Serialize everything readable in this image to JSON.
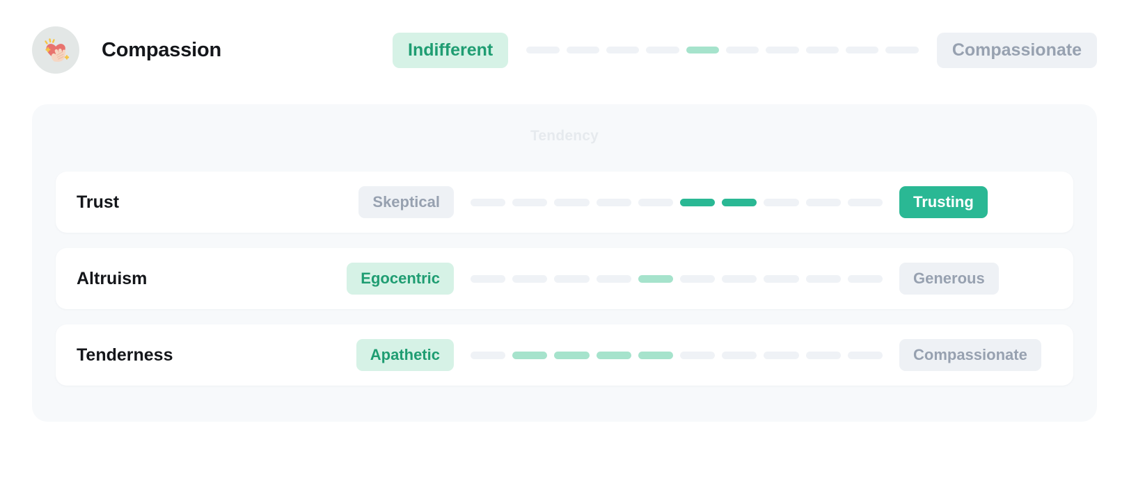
{
  "header": {
    "icon_name": "heart-with-hand-icon",
    "title": "Compassion",
    "left_label": "Indifferent",
    "right_label": "Compassionate",
    "segments_total": 10,
    "value_index": 4
  },
  "panel": {
    "heading": "Tendency"
  },
  "colors": {
    "accent_solid": "#2ab894",
    "accent_soft": "#a6e3cc",
    "badge_soft_bg": "#d6f2e6",
    "badge_soft_text": "#1f9d72",
    "badge_gray_bg": "#eef1f5",
    "badge_gray_text": "#97a1b0",
    "track_off": "#eff2f6",
    "panel_bg": "#f7f9fb",
    "heading_text": "#e6eaee"
  },
  "facets": [
    {
      "name": "Trust",
      "left_label": "Skeptical",
      "left_style": "gray",
      "right_label": "Trusting",
      "right_style": "green-solid",
      "segments_total": 10,
      "active_indices": [
        5,
        6
      ],
      "fill_style": "solid"
    },
    {
      "name": "Altruism",
      "left_label": "Egocentric",
      "left_style": "green-soft",
      "right_label": "Generous",
      "right_style": "gray",
      "segments_total": 10,
      "active_indices": [
        4
      ],
      "fill_style": "soft"
    },
    {
      "name": "Tenderness",
      "left_label": "Apathetic",
      "left_style": "green-soft",
      "right_label": "Compassionate",
      "right_style": "gray",
      "segments_total": 10,
      "active_indices": [
        1,
        2,
        3,
        4
      ],
      "fill_style": "soft"
    }
  ]
}
